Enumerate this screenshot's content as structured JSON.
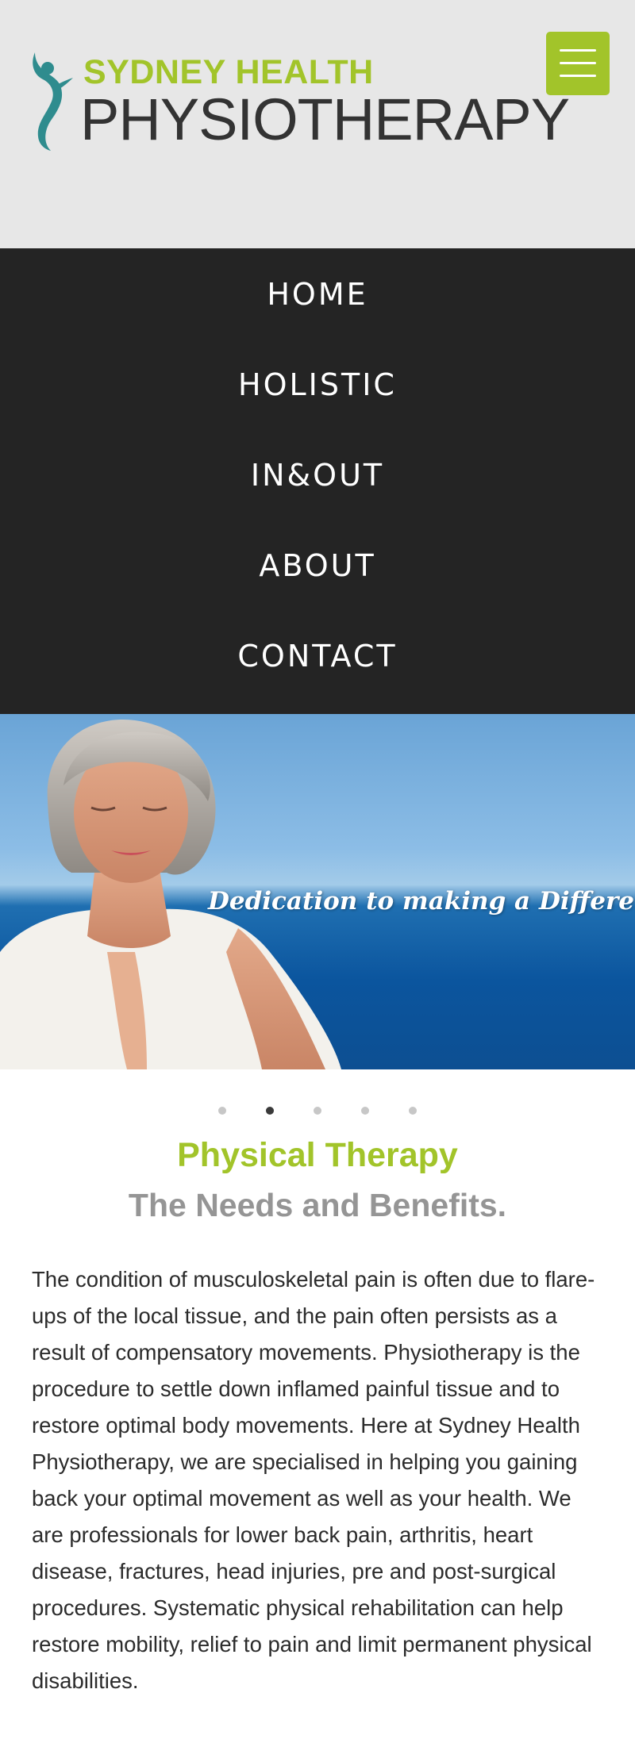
{
  "header": {
    "logo_line1": "SYDNEY HEALTH",
    "logo_line2": "PHYSIOTHERAPY",
    "logo_icon": "dancing-figure-logo",
    "menu_icon": "hamburger-icon"
  },
  "nav": {
    "items": [
      {
        "label": "HOME"
      },
      {
        "label": "HOLISTIC"
      },
      {
        "label": "IN&OUT"
      },
      {
        "label": "ABOUT"
      },
      {
        "label": "CONTACT"
      }
    ]
  },
  "hero": {
    "caption": "Dedication to making a Difference",
    "image": "woman-meditating-by-sea"
  },
  "carousel": {
    "slide_count": 5,
    "active_index": 1
  },
  "main": {
    "title": "Physical Therapy",
    "subtitle": "The Needs and Benefits.",
    "paragraph": "The condition of musculoskeletal pain is often due to flare-ups of the local tissue, and the pain often persists as a result of compensatory movements. Physiotherapy is the procedure to settle down inflamed painful tissue and to restore optimal body movements. Here at Sydney Health Physiotherapy, we are specialised in helping you gaining back your optimal movement as well as your health. We are professionals for lower back pain, arthritis, heart disease, fractures, head injuries, pre and post-surgical procedures. Systematic physical rehabilitation can help restore mobility, relief to pain and limit permanent physical disabilities."
  },
  "colors": {
    "accent": "#a2c42a",
    "nav_background": "#242424",
    "header_background": "#e7e7e7",
    "subtitle_gray": "#959595"
  }
}
